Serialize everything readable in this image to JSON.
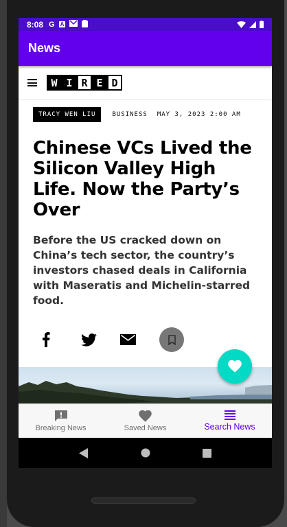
{
  "status_bar": {
    "time": "8:08",
    "left_icons": [
      "G",
      "A",
      "mail-icon",
      "clipboard-icon"
    ],
    "right_icons": [
      "wifi-icon",
      "signal-icon",
      "battery-icon"
    ]
  },
  "app_bar": {
    "title": "News"
  },
  "article": {
    "site_logo_letters": [
      "W",
      "I",
      "R",
      "E",
      "D"
    ],
    "author": "TRACY WEN LIU",
    "category": "BUSINESS",
    "date": "MAY 3, 2023 2:00 AM",
    "headline": "Chinese VCs Lived the Silicon Valley High Life. Now the Party’s Over",
    "dek": "Before the US cracked down on China’s tech sector, the country’s investors chased deals in California with Maseratis and Michelin-starred food.",
    "share_icons": [
      "facebook-icon",
      "twitter-icon",
      "email-icon",
      "bookmark-icon"
    ]
  },
  "fab": {
    "icon": "heart-icon",
    "color": "#03dac5"
  },
  "bottom_nav": {
    "items": [
      {
        "label": "Breaking News",
        "icon": "alert-message-icon",
        "active": false
      },
      {
        "label": "Saved News",
        "icon": "heart-icon",
        "active": false
      },
      {
        "label": "Search News",
        "icon": "list-icon",
        "active": true
      }
    ]
  },
  "colors": {
    "primary": "#6200ee",
    "primary_dark": "#4a0ec9",
    "accent": "#03dac5"
  }
}
